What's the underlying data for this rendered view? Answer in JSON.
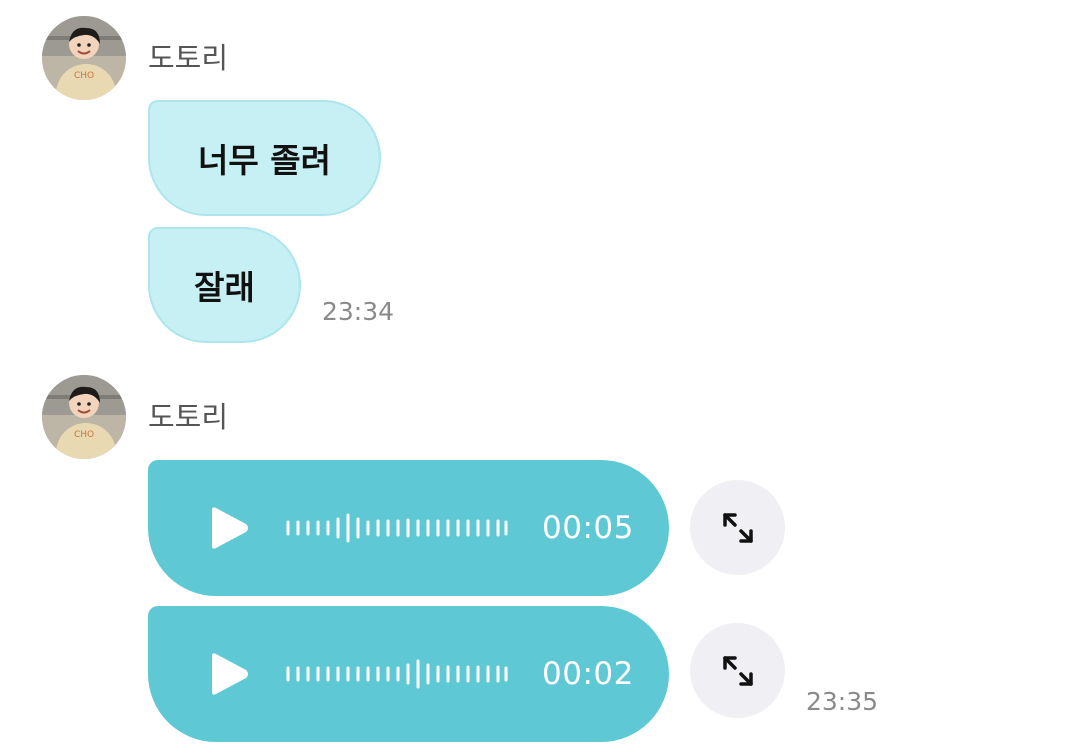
{
  "groups": [
    {
      "sender": "도토리",
      "messages": [
        "너무 졸려",
        "잘래"
      ],
      "time": "23:34"
    },
    {
      "sender": "도토리",
      "voice_messages": [
        {
          "duration": "00:05"
        },
        {
          "duration": "00:02"
        }
      ],
      "time": "23:35"
    }
  ],
  "colors": {
    "text_bubble": "#c6f0f3",
    "voice_bubble": "#5ec8d4",
    "expand_button": "#f0f0f4"
  },
  "icons": {
    "play": "play-icon",
    "waveform": "waveform-icon",
    "expand": "expand-arrows-icon"
  }
}
